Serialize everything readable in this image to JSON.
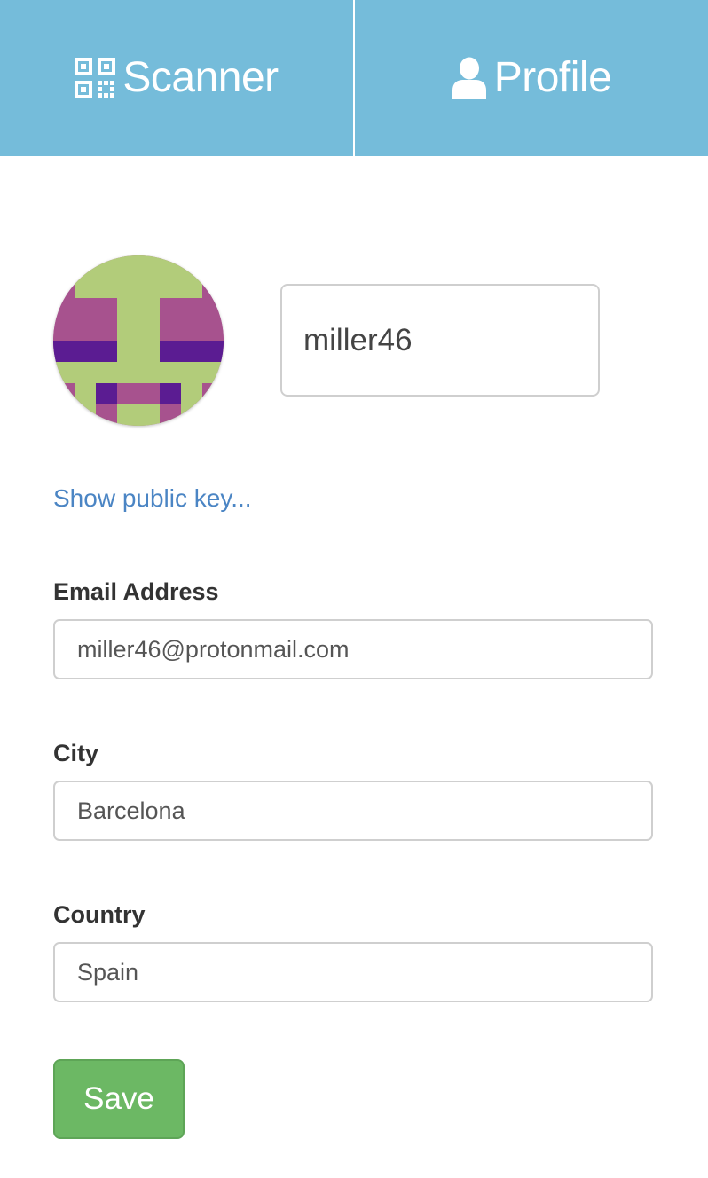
{
  "nav": {
    "scanner_label": "Scanner",
    "scanner_icon": "qr-code-icon",
    "profile_label": "Profile",
    "profile_icon": "user-icon",
    "bar_color": "#75bcda"
  },
  "profile": {
    "avatar": "identicon-avatar",
    "username": "miller46",
    "show_key_link": "Show public key..."
  },
  "form": {
    "email_label": "Email Address",
    "email_value": "miller46@protonmail.com",
    "city_label": "City",
    "city_value": "Barcelona",
    "country_label": "Country",
    "country_value": "Spain",
    "save_label": "Save",
    "save_color": "#6cb864",
    "link_color": "#4b85c4"
  }
}
